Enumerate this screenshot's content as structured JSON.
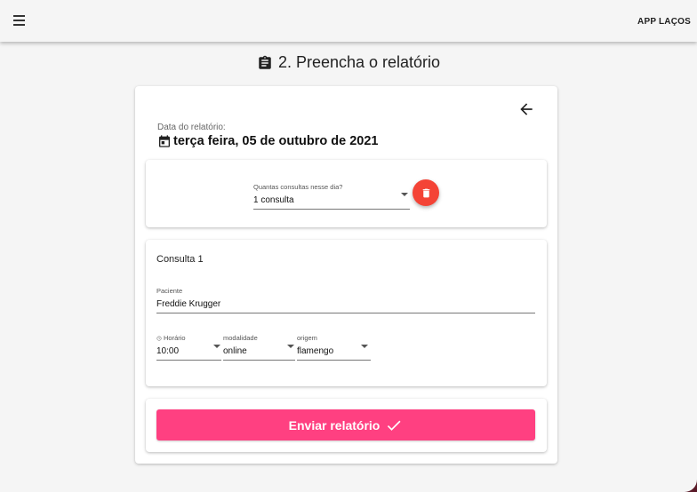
{
  "appbar": {
    "menu_icon": "menu-icon",
    "title": "APP LAÇOS"
  },
  "page": {
    "heading": "2. Preencha o relatório",
    "heading_icon": "clipboard-icon"
  },
  "report": {
    "back_icon": "arrow-back-icon",
    "date_label": "Data do relatório:",
    "date_value": "terça feira, 05 de outubro de 2021",
    "date_icon": "calendar-icon"
  },
  "count_field": {
    "label": "Quantas consultas nesse dia?",
    "value": "1 consulta",
    "delete_icon": "trash-icon",
    "delete_color": "#f44336"
  },
  "consulta": {
    "title": "Consulta 1",
    "patient_label": "Paciente",
    "patient_value": "Freddie Krugger",
    "time_label": "Horário",
    "time_value": "10:00",
    "modality_label": "modalidade",
    "modality_value": "online",
    "origin_label": "origem",
    "origin_value": "flamengo"
  },
  "submit": {
    "label": "Enviar relatório",
    "icon": "check-icon",
    "color": "#ff4081"
  }
}
